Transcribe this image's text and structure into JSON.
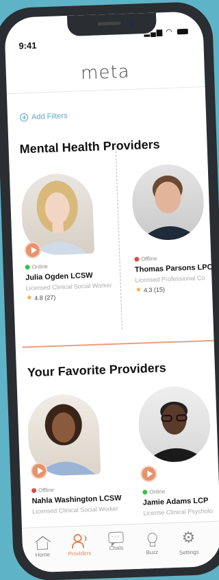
{
  "status_bar": {
    "time": "9:41",
    "signal": "▂▄▆",
    "wifi": "◠"
  },
  "app": {
    "logo": "meta"
  },
  "filters": {
    "label": "Add Filters"
  },
  "sections": {
    "mental_health": {
      "title": "Mental Health Providers"
    },
    "favorites": {
      "title": "Your Favorite Providers"
    }
  },
  "providers": [
    {
      "name": "Julia Ogden LCSW",
      "role": "Licensed Clinical Social Worker",
      "status": "Online",
      "rating": "4.8 (27)"
    },
    {
      "name": "Thomas Parsons LPC",
      "role": "Licensed Professional Co",
      "status": "Offline",
      "rating": "4.3 (15)"
    }
  ],
  "favorites": [
    {
      "name": "Nahla Washington LCSW",
      "role": "Licensed Clinical Social Worker",
      "status": "Offline"
    },
    {
      "name": "Jamie Adams LCP",
      "role": "License Clinical Psycholo",
      "status": "Online"
    }
  ],
  "tabs": [
    {
      "label": "Home",
      "icon": "home-icon"
    },
    {
      "label": "Providers",
      "icon": "providers-icon"
    },
    {
      "label": "Chats",
      "icon": "chat-icon"
    },
    {
      "label": "Buzz",
      "icon": "lightbulb-icon"
    },
    {
      "label": "Settings",
      "icon": "gear-icon"
    }
  ],
  "colors": {
    "accent": "#e38758",
    "link": "#59a9c9",
    "online": "#3fbf4a",
    "offline": "#e04b4b",
    "background": "#5fb3c6"
  }
}
